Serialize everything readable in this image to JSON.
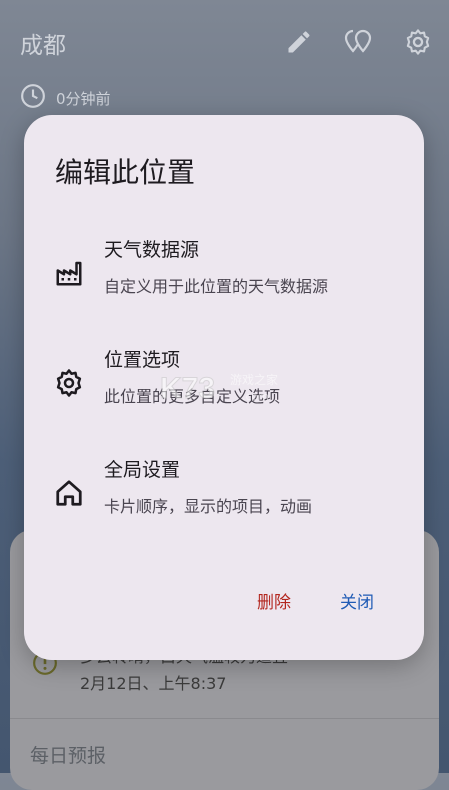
{
  "header": {
    "city": "成都",
    "updated": "0分钟前"
  },
  "background": {
    "alert": {
      "title": "多云转晴，白天气温较为适宜",
      "time": "2月12日、上午8:37"
    },
    "daily_title": "每日预报"
  },
  "dialog": {
    "title": "编辑此位置",
    "options": [
      {
        "label": "天气数据源",
        "desc": "自定义用于此位置的天气数据源",
        "icon": "factory-icon"
      },
      {
        "label": "位置选项",
        "desc": "此位置的更多自定义选项",
        "icon": "gear-icon"
      },
      {
        "label": "全局设置",
        "desc": "卡片顺序，显示的项目，动画",
        "icon": "home-icon"
      }
    ],
    "delete_label": "删除",
    "close_label": "关闭"
  },
  "watermark": {
    "logo": "K73",
    "text": "游戏之家",
    "url": ".com"
  },
  "colors": {
    "dialog_bg": "#ede7ef",
    "delete": "#b3261e",
    "close": "#1f5bb5"
  }
}
